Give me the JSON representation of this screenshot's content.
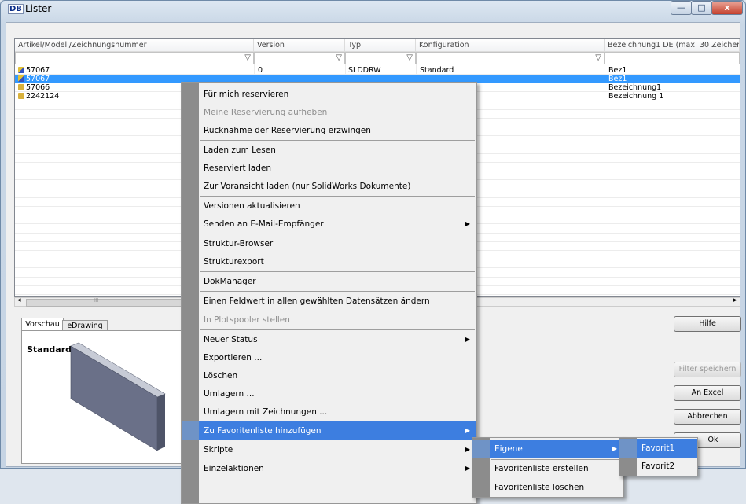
{
  "window": {
    "logo": "DB",
    "title": "Lister",
    "min": "—",
    "max": "□",
    "close": "x"
  },
  "grid": {
    "columns": [
      "Artikel/Modell/Zeichnungsnummer",
      "Version",
      "Typ",
      "Konfiguration",
      "Bezeichnung1 DE (max. 30 Zeichen)"
    ],
    "rows": [
      {
        "nr": "57067",
        "version": "0",
        "typ": "SLDDRW",
        "konf": "Standard",
        "bez": "Bez1",
        "selected": false
      },
      {
        "nr": "57067",
        "version": "",
        "typ": "",
        "konf": "",
        "bez": "Bez1",
        "selected": true
      },
      {
        "nr": "57066",
        "version": "",
        "typ": "",
        "konf": "",
        "bez": "Bezeichnung1",
        "selected": false
      },
      {
        "nr": "2242124",
        "version": "",
        "typ": "",
        "konf": "",
        "bez": "Bezeichnung 1",
        "selected": false
      }
    ],
    "scroll_left": "◂",
    "scroll_right": "▸",
    "scroll_thumb": "III"
  },
  "preview": {
    "tab1": "Vorschau",
    "tab2": "eDrawing",
    "config": "Standard"
  },
  "buttons": {
    "hilfe": "Hilfe",
    "filter": "Filter speichern",
    "excel": "An Excel",
    "abbrechen": "Abbrechen",
    "ok": "Ok"
  },
  "context_menu": [
    "Für mich reservieren",
    "Meine Reservierung aufheben",
    "Rücknahme der Reservierung erzwingen",
    "Laden zum Lesen",
    "Reserviert laden",
    "Zur Voransicht laden (nur SolidWorks Dokumente)",
    "Versionen aktualisieren",
    "Senden an E-Mail-Empfänger",
    "Struktur-Browser",
    "Strukturexport",
    "DokManager",
    "Einen Feldwert in allen gewählten Datensätzen ändern",
    "In Plotspooler stellen",
    "Neuer Status",
    "Exportieren ...",
    "Löschen",
    "Umlagern ...",
    "Umlagern mit Zeichnungen ...",
    "Zu Favoritenliste hinzufügen",
    "Skripte",
    "Einzelaktionen"
  ],
  "submenu_favoriten": [
    "Eigene",
    "Favoritenliste erstellen",
    "Favoritenliste löschen"
  ],
  "submenu_eigene": [
    "Favorit1",
    "Favorit2"
  ],
  "colors": {
    "selection": "#3399ff",
    "menu_highlight": "#3d7ee0",
    "gutter": "#8c8c8c"
  }
}
